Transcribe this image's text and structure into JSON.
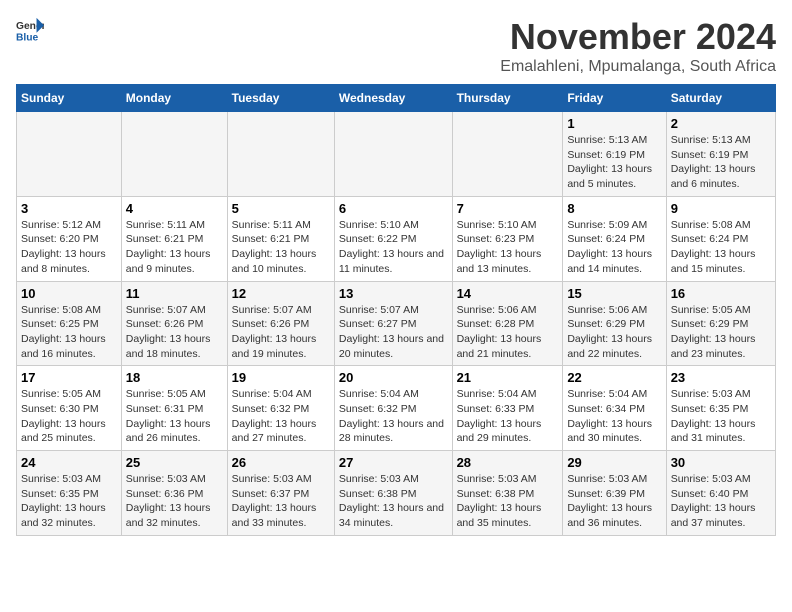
{
  "logo": {
    "general": "General",
    "blue": "Blue"
  },
  "title": "November 2024",
  "subtitle": "Emalahleni, Mpumalanga, South Africa",
  "days_of_week": [
    "Sunday",
    "Monday",
    "Tuesday",
    "Wednesday",
    "Thursday",
    "Friday",
    "Saturday"
  ],
  "weeks": [
    [
      {
        "day": "",
        "content": ""
      },
      {
        "day": "",
        "content": ""
      },
      {
        "day": "",
        "content": ""
      },
      {
        "day": "",
        "content": ""
      },
      {
        "day": "",
        "content": ""
      },
      {
        "day": "1",
        "content": "Sunrise: 5:13 AM\nSunset: 6:19 PM\nDaylight: 13 hours and 5 minutes."
      },
      {
        "day": "2",
        "content": "Sunrise: 5:13 AM\nSunset: 6:19 PM\nDaylight: 13 hours and 6 minutes."
      }
    ],
    [
      {
        "day": "3",
        "content": "Sunrise: 5:12 AM\nSunset: 6:20 PM\nDaylight: 13 hours and 8 minutes."
      },
      {
        "day": "4",
        "content": "Sunrise: 5:11 AM\nSunset: 6:21 PM\nDaylight: 13 hours and 9 minutes."
      },
      {
        "day": "5",
        "content": "Sunrise: 5:11 AM\nSunset: 6:21 PM\nDaylight: 13 hours and 10 minutes."
      },
      {
        "day": "6",
        "content": "Sunrise: 5:10 AM\nSunset: 6:22 PM\nDaylight: 13 hours and 11 minutes."
      },
      {
        "day": "7",
        "content": "Sunrise: 5:10 AM\nSunset: 6:23 PM\nDaylight: 13 hours and 13 minutes."
      },
      {
        "day": "8",
        "content": "Sunrise: 5:09 AM\nSunset: 6:24 PM\nDaylight: 13 hours and 14 minutes."
      },
      {
        "day": "9",
        "content": "Sunrise: 5:08 AM\nSunset: 6:24 PM\nDaylight: 13 hours and 15 minutes."
      }
    ],
    [
      {
        "day": "10",
        "content": "Sunrise: 5:08 AM\nSunset: 6:25 PM\nDaylight: 13 hours and 16 minutes."
      },
      {
        "day": "11",
        "content": "Sunrise: 5:07 AM\nSunset: 6:26 PM\nDaylight: 13 hours and 18 minutes."
      },
      {
        "day": "12",
        "content": "Sunrise: 5:07 AM\nSunset: 6:26 PM\nDaylight: 13 hours and 19 minutes."
      },
      {
        "day": "13",
        "content": "Sunrise: 5:07 AM\nSunset: 6:27 PM\nDaylight: 13 hours and 20 minutes."
      },
      {
        "day": "14",
        "content": "Sunrise: 5:06 AM\nSunset: 6:28 PM\nDaylight: 13 hours and 21 minutes."
      },
      {
        "day": "15",
        "content": "Sunrise: 5:06 AM\nSunset: 6:29 PM\nDaylight: 13 hours and 22 minutes."
      },
      {
        "day": "16",
        "content": "Sunrise: 5:05 AM\nSunset: 6:29 PM\nDaylight: 13 hours and 23 minutes."
      }
    ],
    [
      {
        "day": "17",
        "content": "Sunrise: 5:05 AM\nSunset: 6:30 PM\nDaylight: 13 hours and 25 minutes."
      },
      {
        "day": "18",
        "content": "Sunrise: 5:05 AM\nSunset: 6:31 PM\nDaylight: 13 hours and 26 minutes."
      },
      {
        "day": "19",
        "content": "Sunrise: 5:04 AM\nSunset: 6:32 PM\nDaylight: 13 hours and 27 minutes."
      },
      {
        "day": "20",
        "content": "Sunrise: 5:04 AM\nSunset: 6:32 PM\nDaylight: 13 hours and 28 minutes."
      },
      {
        "day": "21",
        "content": "Sunrise: 5:04 AM\nSunset: 6:33 PM\nDaylight: 13 hours and 29 minutes."
      },
      {
        "day": "22",
        "content": "Sunrise: 5:04 AM\nSunset: 6:34 PM\nDaylight: 13 hours and 30 minutes."
      },
      {
        "day": "23",
        "content": "Sunrise: 5:03 AM\nSunset: 6:35 PM\nDaylight: 13 hours and 31 minutes."
      }
    ],
    [
      {
        "day": "24",
        "content": "Sunrise: 5:03 AM\nSunset: 6:35 PM\nDaylight: 13 hours and 32 minutes."
      },
      {
        "day": "25",
        "content": "Sunrise: 5:03 AM\nSunset: 6:36 PM\nDaylight: 13 hours and 32 minutes."
      },
      {
        "day": "26",
        "content": "Sunrise: 5:03 AM\nSunset: 6:37 PM\nDaylight: 13 hours and 33 minutes."
      },
      {
        "day": "27",
        "content": "Sunrise: 5:03 AM\nSunset: 6:38 PM\nDaylight: 13 hours and 34 minutes."
      },
      {
        "day": "28",
        "content": "Sunrise: 5:03 AM\nSunset: 6:38 PM\nDaylight: 13 hours and 35 minutes."
      },
      {
        "day": "29",
        "content": "Sunrise: 5:03 AM\nSunset: 6:39 PM\nDaylight: 13 hours and 36 minutes."
      },
      {
        "day": "30",
        "content": "Sunrise: 5:03 AM\nSunset: 6:40 PM\nDaylight: 13 hours and 37 minutes."
      }
    ]
  ]
}
